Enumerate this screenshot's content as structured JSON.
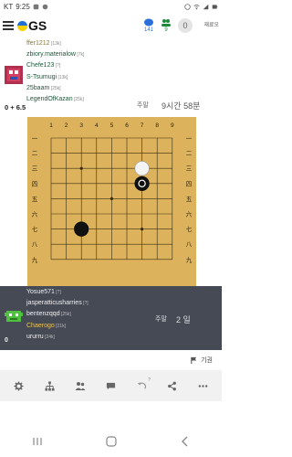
{
  "status_bar": {
    "carrier": "KT",
    "time": "9:25"
  },
  "nav": {
    "logo_text": "GS",
    "notifications": {
      "count": "141"
    },
    "friends": {
      "count": "9"
    },
    "avatar_letter": "0",
    "username": "재료오"
  },
  "top_player": {
    "names": [
      {
        "name": "ffer1212",
        "rank": "[13k]",
        "style": "dim"
      },
      {
        "name": "zbiory.materialow",
        "rank": "[7k]",
        "style": "green"
      },
      {
        "name": "Chefe123",
        "rank": "[?]",
        "style": "green"
      },
      {
        "name": "S-Tsumugi",
        "rank": "[13k]",
        "style": "green"
      },
      {
        "name": "25baam",
        "rank": "[25k]",
        "style": "green"
      },
      {
        "name": "LegendOfKazan",
        "rank": "[25k]",
        "style": "green"
      }
    ],
    "clock_label": "주말",
    "clock_value": "9시간 58분",
    "score": "0 + 6.5"
  },
  "board": {
    "size": 9,
    "col_labels": [
      "1",
      "2",
      "3",
      "4",
      "5",
      "6",
      "7",
      "8",
      "9"
    ],
    "row_labels": [
      "一",
      "二",
      "三",
      "四",
      "五",
      "六",
      "七",
      "八",
      "九"
    ],
    "stones": [
      {
        "color": "white",
        "col": 7,
        "row": 3,
        "last": false
      },
      {
        "color": "black",
        "col": 7,
        "row": 4,
        "last": true
      },
      {
        "color": "black",
        "col": 3,
        "row": 7,
        "last": false
      }
    ],
    "star_points": [
      [
        3,
        3
      ],
      [
        7,
        3
      ],
      [
        5,
        5
      ],
      [
        3,
        7
      ],
      [
        7,
        7
      ]
    ]
  },
  "bottom_player": {
    "names": [
      {
        "name": "Yosue571",
        "rank": "[?]",
        "style": "normal"
      },
      {
        "name": "jasperatticusharries",
        "rank": "[?]",
        "style": "normal"
      },
      {
        "name": "bentenzqqd",
        "rank": "[25k]",
        "style": "normal"
      },
      {
        "name": "Chaerogo",
        "rank": "[21k]",
        "style": "gold"
      },
      {
        "name": "ururru",
        "rank": "[24k]",
        "style": "normal"
      }
    ],
    "clock_label": "주말",
    "clock_value": "2 일",
    "score": "0"
  },
  "toolbar": {
    "give_up_label": "기권"
  },
  "actions": [
    "gear-icon",
    "tree-icon",
    "people-icon",
    "chat-icon",
    "undo-icon",
    "share-icon",
    "more-icon"
  ],
  "colors": {
    "board": "#dcb35c",
    "panel_dark": "#454a55",
    "accent_gold": "#f3c44a"
  }
}
